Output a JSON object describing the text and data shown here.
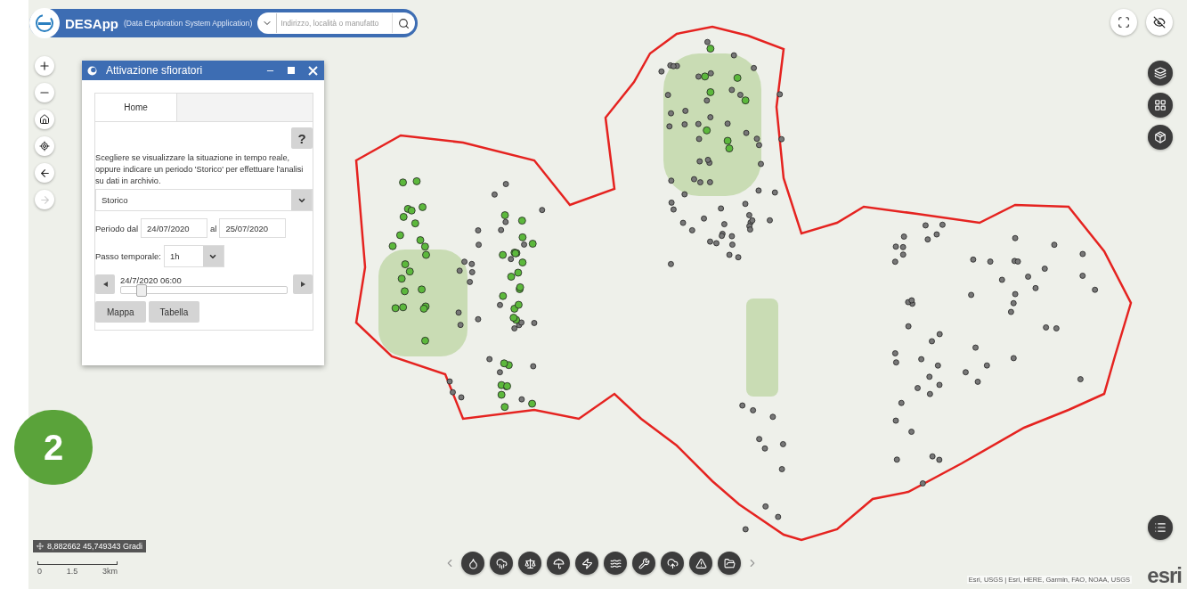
{
  "header": {
    "title": "DESApp",
    "subtitle": "(Data Exploration System Application)",
    "search": {
      "placeholder": "Indirizzo, località o manufatto"
    }
  },
  "panel": {
    "title": "Attivazione sfioratori",
    "tabs": [
      {
        "label": "Home",
        "selected": true
      }
    ],
    "help": "?",
    "description": "Scegliere se visualizzare la situazione in tempo reale, oppure indicare un periodo 'Storico' per effettuare l'analisi su dati in archivio.",
    "mode": {
      "value": "Storico"
    },
    "period": {
      "label": "Periodo dal",
      "from": "24/07/2020",
      "to_label": "al",
      "to": "25/07/2020"
    },
    "step": {
      "label": "Passo temporale:",
      "value": "1h"
    },
    "time_slider": {
      "reading": "24/7/2020 06:00",
      "level": 0.12
    },
    "buttons": [
      "Mappa",
      "Tabella"
    ]
  },
  "badge": "2",
  "coordinates": "8,882662 45,749343 Gradi",
  "scale": {
    "ticks": [
      "0",
      "1.5",
      "3km"
    ]
  },
  "attribution": "Esri, USGS | Esri, HERE, Garmin, FAO, NOAA, USGS",
  "logo": "esri"
}
